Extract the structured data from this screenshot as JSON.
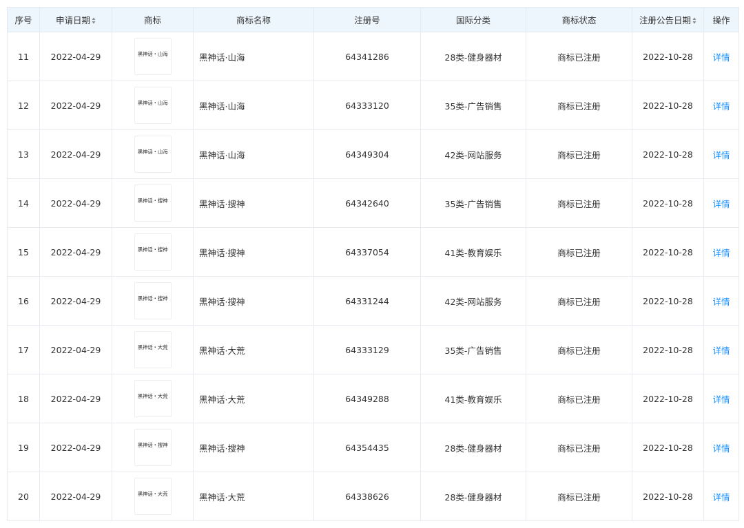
{
  "table": {
    "headers": {
      "seq": "序号",
      "apply_date": "申请日期",
      "logo": "商标",
      "name": "商标名称",
      "reg_no": "注册号",
      "intl_class": "国际分类",
      "status": "商标状态",
      "pub_date": "注册公告日期",
      "action": "操作"
    },
    "sortable_columns": [
      "apply_date",
      "pub_date"
    ],
    "rows": [
      {
        "seq": "11",
        "apply_date": "2022-04-29",
        "logo_text": "黑神话・山海",
        "name": "黑神话·山海",
        "reg_no": "64341286",
        "intl_class": "28类-健身器材",
        "status": "商标已注册",
        "pub_date": "2022-10-28",
        "action": "详情"
      },
      {
        "seq": "12",
        "apply_date": "2022-04-29",
        "logo_text": "黑神话・山海",
        "name": "黑神话·山海",
        "reg_no": "64333120",
        "intl_class": "35类-广告销售",
        "status": "商标已注册",
        "pub_date": "2022-10-28",
        "action": "详情"
      },
      {
        "seq": "13",
        "apply_date": "2022-04-29",
        "logo_text": "黑神话・山海",
        "name": "黑神话·山海",
        "reg_no": "64349304",
        "intl_class": "42类-网站服务",
        "status": "商标已注册",
        "pub_date": "2022-10-28",
        "action": "详情"
      },
      {
        "seq": "14",
        "apply_date": "2022-04-29",
        "logo_text": "黑神话・搜神",
        "name": "黑神话·搜神",
        "reg_no": "64342640",
        "intl_class": "35类-广告销售",
        "status": "商标已注册",
        "pub_date": "2022-10-28",
        "action": "详情"
      },
      {
        "seq": "15",
        "apply_date": "2022-04-29",
        "logo_text": "黑神话・搜神",
        "name": "黑神话·搜神",
        "reg_no": "64337054",
        "intl_class": "41类-教育娱乐",
        "status": "商标已注册",
        "pub_date": "2022-10-28",
        "action": "详情"
      },
      {
        "seq": "16",
        "apply_date": "2022-04-29",
        "logo_text": "黑神话・搜神",
        "name": "黑神话·搜神",
        "reg_no": "64331244",
        "intl_class": "42类-网站服务",
        "status": "商标已注册",
        "pub_date": "2022-10-28",
        "action": "详情"
      },
      {
        "seq": "17",
        "apply_date": "2022-04-29",
        "logo_text": "黑神话・大荒",
        "name": "黑神话·大荒",
        "reg_no": "64333129",
        "intl_class": "35类-广告销售",
        "status": "商标已注册",
        "pub_date": "2022-10-28",
        "action": "详情"
      },
      {
        "seq": "18",
        "apply_date": "2022-04-29",
        "logo_text": "黑神话・大荒",
        "name": "黑神话·大荒",
        "reg_no": "64349288",
        "intl_class": "41类-教育娱乐",
        "status": "商标已注册",
        "pub_date": "2022-10-28",
        "action": "详情"
      },
      {
        "seq": "19",
        "apply_date": "2022-04-29",
        "logo_text": "黑神话・搜神",
        "name": "黑神话·搜神",
        "reg_no": "64354435",
        "intl_class": "28类-健身器材",
        "status": "商标已注册",
        "pub_date": "2022-10-28",
        "action": "详情"
      },
      {
        "seq": "20",
        "apply_date": "2022-04-29",
        "logo_text": "黑神话・大荒",
        "name": "黑神话·大荒",
        "reg_no": "64338626",
        "intl_class": "28类-健身器材",
        "status": "商标已注册",
        "pub_date": "2022-10-28",
        "action": "详情"
      }
    ]
  },
  "icons": {
    "sort": "sort-icon"
  },
  "colors": {
    "header_bg": "#edf6fc",
    "border": "#e8ecf0",
    "link": "#1890ff",
    "text": "#333333"
  }
}
